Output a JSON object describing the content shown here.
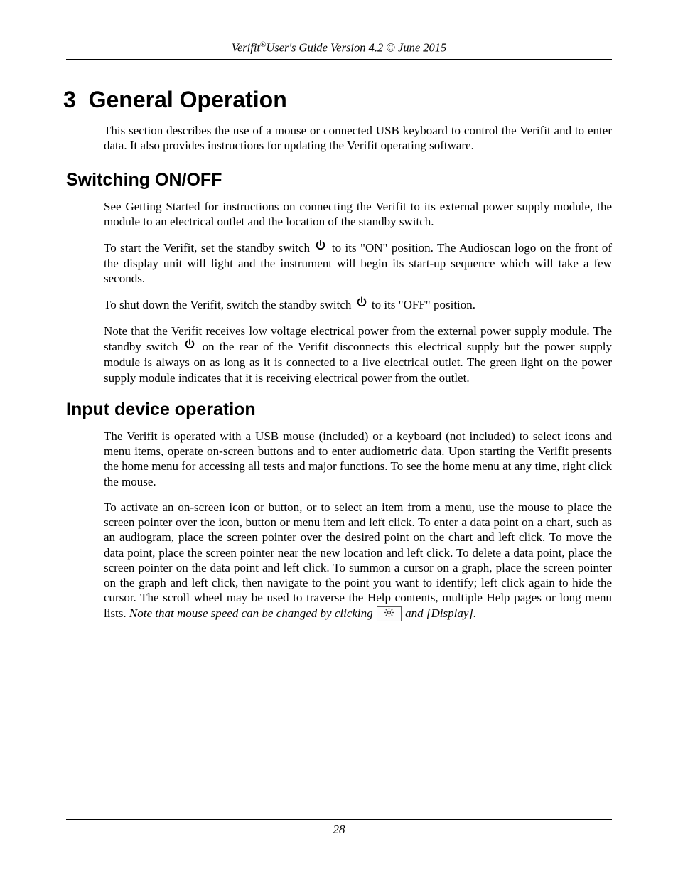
{
  "header": {
    "product": "Verifit",
    "reg": "®",
    "rest": "User's Guide Version 4.2 © June 2015"
  },
  "chapter": {
    "number": "3",
    "title": "General Operation"
  },
  "intro": "This section describes the use of a mouse or connected USB keyboard to control the Verifit and to enter data. It also provides instructions for updating the Verifit operating software.",
  "section1": {
    "title": "Switching ON/OFF",
    "p1": "See Getting Started for instructions on connecting the Verifit to its external power supply module, the module to an electrical outlet and the location of the standby switch.",
    "p2a": "To start the Verifit, set the standby switch ",
    "p2b": " to its \"ON\" position. The Audioscan logo on the front of the display unit will light and the instrument will begin its start-up sequence which will take a few seconds.",
    "p3a": "To shut down the Verifit, switch the standby switch ",
    "p3b": " to its \"OFF\" position.",
    "p4a": "Note that the Verifit receives low voltage electrical power from the external power supply module. The standby switch ",
    "p4b": " on the rear of the Verifit disconnects this electrical supply but the power supply module is always on as long as it is connected to a live electrical outlet. The green light on the power supply module indicates that it is receiving electrical power from the outlet."
  },
  "section2": {
    "title": "Input device operation",
    "p1": "The Verifit is operated with a USB mouse (included) or a keyboard (not included) to select icons and menu items, operate on-screen buttons and to enter audiometric data. Upon starting the Verifit presents the home menu for accessing all tests and major functions. To see the home menu at any time, right click the mouse.",
    "p2a": "To activate an on-screen icon or button, or to select an item from a menu, use the mouse to place the screen pointer over the icon, button or menu item and left click. To enter a data point on a chart, such as an audiogram, place the screen pointer over the desired point on the chart and left click. To move the data point, place the screen pointer near the new location and left click. To delete a data point, place the screen pointer on the data point and left click. To summon a cursor on a graph, place the screen pointer on the graph and left click, then navigate to the point you want to identify; left click again to hide the cursor. The scroll wheel may be used to traverse the Help contents, multiple Help pages or long menu lists. ",
    "p2italic1": "Note that mouse speed can be changed by clicking ",
    "p2italic2": " and ",
    "p2display": "[Display]."
  },
  "footer": {
    "page": "28"
  }
}
